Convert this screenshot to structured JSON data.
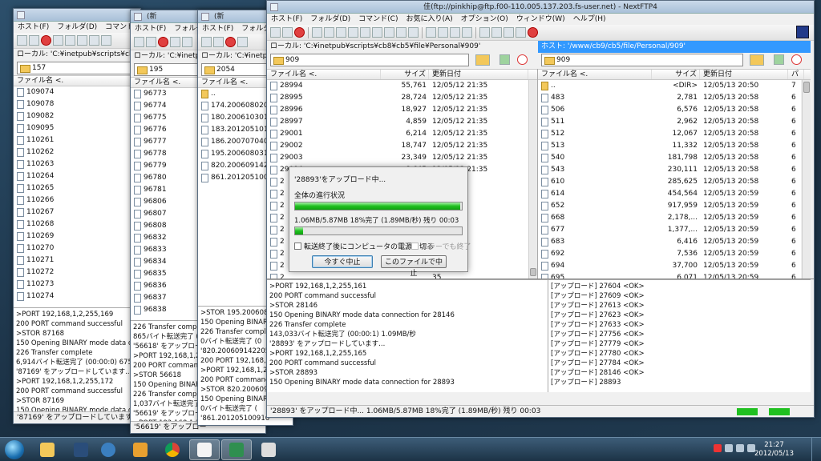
{
  "back_windows": [
    {
      "title": "",
      "menu": [
        "ホスト(F)",
        "フォルダ(D)",
        "コマンド(C)"
      ],
      "local_label": "ローカル: 'C:¥inetpub¥scripts¥cb8¥cb8",
      "folder": "157",
      "col_name": "ファイル名 <.",
      "files": [
        "109074",
        "109078",
        "109082",
        "109095",
        "110261",
        "110262",
        "110263",
        "110264",
        "110265",
        "110266",
        "110267",
        "110268",
        "110269",
        "110270",
        "110271",
        "110272",
        "110273",
        "110274"
      ],
      "log": [
        ">PORT 192,168,1,2,255,169",
        "200 PORT command successful",
        ">STOR 87168",
        "150 Opening BINARY mode data connection",
        "226 Transfer complete",
        "6,914バイト転送完了 (00:00:0) 675.2K",
        "'87169' をアップロードしています...",
        ">PORT 192,168,1,2,255,172",
        "200 PORT command successful",
        ">STOR 87169",
        "150 Opening BINARY mode data connection"
      ],
      "status": "'87169' をアップロードしています..."
    },
    {
      "title": "(新",
      "menu": [
        "ホスト(F)",
        "フォルダ"
      ],
      "local_label": "ローカル: 'C:¥inetpub",
      "folder": "195",
      "col_name": "ファイル名 <.",
      "files": [
        "96773",
        "96774",
        "96775",
        "96776",
        "96777",
        "96778",
        "96779",
        "96780",
        "96781",
        "96806",
        "96807",
        "96808",
        "96832",
        "96833",
        "96834",
        "96835",
        "96836",
        "96837",
        "96838"
      ],
      "log": [
        "226 Transfer complete",
        "865バイト転送完了 (",
        "'56618' をアップロー",
        ">PORT 192,168,1,2,",
        "200 PORT command",
        ">STOR 56618",
        "150 Opening BINARY",
        "226 Transfer complete",
        "1,037バイト転送完了",
        "'56619' をアップロー",
        ">PORT 192,168,1,2,"
      ],
      "status": "'56619' をアップロー"
    },
    {
      "title": "(新",
      "menu": [
        "ホスト(F)",
        "フォルダ"
      ],
      "local_label": "ローカル: 'C:¥inetpub",
      "folder": "2054",
      "col_name": "ファイル名 <.",
      "files": [
        "..",
        "174.20060802085",
        "180.20061030101",
        "183.20120510142",
        "186.20070704073",
        "195.20060803184",
        "820.20060914220",
        "861.20120510091"
      ],
      "log": [
        ">STOR 195.20060803",
        "150 Opening BINARY",
        "226 Transfer complete",
        "0バイト転送完了 (0",
        "'820.200609142205",
        "200 PORT 192,168,1,2",
        ">PORT 192,168,1,2",
        "200 PORT command",
        ">STOR 820.2006091",
        "150 Opening BINARY",
        "0バイト転送完了 (",
        "'861.201205100916"
      ],
      "status": ""
    }
  ],
  "main": {
    "title": "(ftp://pinkhip@ftp.f00-110.005.137.203.fs-user.net) - NextFTP4",
    "title_prefix": "佳",
    "menu": [
      "ホスト(F)",
      "フォルダ(D)",
      "コマンド(C)",
      "お気に入り(A)",
      "オプション(O)",
      "ウィンドウ(W)",
      "ヘルプ(H)"
    ],
    "local_label": "ローカル: 'C:¥inetpub¥scripts¥cb8¥cb5¥file¥Personal¥909'",
    "host_label": "ホスト: '/www/cb9/cb5/file/Personal/909'",
    "local_folder": "909",
    "host_folder": "909",
    "col_name": "ファイル名 <.",
    "col_size": "サイズ",
    "col_date": "更新日付",
    "col_extra": "パ",
    "local_files": [
      {
        "name": "28994",
        "size": "55,761",
        "date": "12/05/12 21:35"
      },
      {
        "name": "28995",
        "size": "28,724",
        "date": "12/05/12 21:35"
      },
      {
        "name": "28996",
        "size": "18,927",
        "date": "12/05/12 21:35"
      },
      {
        "name": "28997",
        "size": "4,859",
        "date": "12/05/12 21:35"
      },
      {
        "name": "29001",
        "size": "6,214",
        "date": "12/05/12 21:35"
      },
      {
        "name": "29002",
        "size": "18,747",
        "date": "12/05/12 21:35"
      },
      {
        "name": "29003",
        "size": "23,349",
        "date": "12/05/12 21:35"
      },
      {
        "name": "29004",
        "size": "8,645",
        "date": "12/05/12 21:35"
      },
      {
        "name": "2",
        "size": "",
        "date": "35"
      },
      {
        "name": "2",
        "size": "",
        "date": "35"
      },
      {
        "name": "2",
        "size": "",
        "date": "35"
      },
      {
        "name": "2",
        "size": "",
        "date": "35"
      },
      {
        "name": "2",
        "size": "",
        "date": "35"
      },
      {
        "name": "2",
        "size": "",
        "date": "35"
      },
      {
        "name": "2",
        "size": "",
        "date": "35"
      },
      {
        "name": "2",
        "size": "",
        "date": "35"
      },
      {
        "name": "2",
        "size": "",
        "date": "35"
      },
      {
        "name": "2",
        "size": "",
        "date": "35"
      },
      {
        "name": "2",
        "size": "",
        "date": "35"
      },
      {
        "name": "29022",
        "size": "6,810",
        "date": "12/05/12 21:35"
      },
      {
        "name": "29023",
        "size": "7,347",
        "date": "12/05/12 21:35"
      }
    ],
    "host_files": [
      {
        "name": "..",
        "size": "<DIR>",
        "date": "12/05/13 20:50",
        "x": "7"
      },
      {
        "name": "483",
        "size": "2,781",
        "date": "12/05/13 20:58",
        "x": "6"
      },
      {
        "name": "506",
        "size": "6,576",
        "date": "12/05/13 20:58",
        "x": "6"
      },
      {
        "name": "511",
        "size": "2,962",
        "date": "12/05/13 20:58",
        "x": "6"
      },
      {
        "name": "512",
        "size": "12,067",
        "date": "12/05/13 20:58",
        "x": "6"
      },
      {
        "name": "513",
        "size": "11,332",
        "date": "12/05/13 20:58",
        "x": "6"
      },
      {
        "name": "540",
        "size": "181,798",
        "date": "12/05/13 20:58",
        "x": "6"
      },
      {
        "name": "543",
        "size": "230,111",
        "date": "12/05/13 20:58",
        "x": "6"
      },
      {
        "name": "610",
        "size": "285,625",
        "date": "12/05/13 20:58",
        "x": "6"
      },
      {
        "name": "614",
        "size": "454,564",
        "date": "12/05/13 20:59",
        "x": "6"
      },
      {
        "name": "652",
        "size": "917,959",
        "date": "12/05/13 20:59",
        "x": "6"
      },
      {
        "name": "668",
        "size": "2,178,...",
        "date": "12/05/13 20:59",
        "x": "6"
      },
      {
        "name": "677",
        "size": "1,377,...",
        "date": "12/05/13 20:59",
        "x": "6"
      },
      {
        "name": "683",
        "size": "6,416",
        "date": "12/05/13 20:59",
        "x": "6"
      },
      {
        "name": "692",
        "size": "7,536",
        "date": "12/05/13 20:59",
        "x": "6"
      },
      {
        "name": "694",
        "size": "37,700",
        "date": "12/05/13 20:59",
        "x": "6"
      },
      {
        "name": "695",
        "size": "6,071",
        "date": "12/05/13 20:59",
        "x": "6"
      },
      {
        "name": "708",
        "size": "6,760",
        "date": "12/05/13 20:59",
        "x": "6"
      }
    ],
    "log_left": [
      ">PORT 192,168,1,2,255,161",
      "200 PORT command successful",
      ">STOR 28146",
      "150 Opening BINARY mode data connection for 28146",
      "226 Transfer complete",
      "143,033バイト転送完了 (00:00:1) 1.09MB/秒",
      "'28893' をアップロードしています...",
      ">PORT 192,168,1,2,255,165",
      "200 PORT command successful",
      ">STOR 28893",
      "150 Opening BINARY mode data connection for 28893"
    ],
    "log_right": [
      "[アップロード] 27604 <OK>",
      "[アップロード] 27609 <OK>",
      "[アップロード] 27613 <OK>",
      "[アップロード] 27623 <OK>",
      "[アップロード] 27633 <OK>",
      "[アップロード] 27756 <OK>",
      "[アップロード] 27779 <OK>",
      "[アップロード] 27780 <OK>",
      "[アップロード] 27784 <OK>",
      "[アップロード] 28146 <OK>",
      "[アップロード] 28893"
    ],
    "status": "'28893' をアップロード中... 1.06MB/5.87MB  18%完了 (1.89MB/秒) 残り 00:03"
  },
  "dialog": {
    "title": "'28893'をアップロード中...",
    "overall_label": "全体の進行状況",
    "overall_progress": 0.99,
    "file_progress": 0.05,
    "detail": "1.06MB/5.87MB  18%完了 (1.89MB/秒) 残り 00:03",
    "chk_shutdown": "転送終了後にコンピュータの電源を切る",
    "chk_error": "エラーでも終了",
    "btn_stop_now": "今すぐ中止",
    "btn_stop_after": "このファイルで中止"
  },
  "taskbar": {
    "time": "21:27",
    "date": "2012/05/13"
  },
  "colors": {
    "progress_green": "#20c020",
    "selection_blue": "#3399ff",
    "taskbar": "#1c3346"
  }
}
